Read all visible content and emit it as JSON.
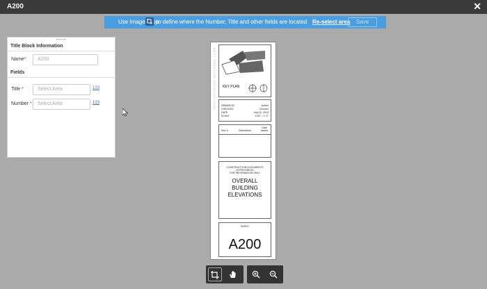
{
  "window": {
    "title": "A200",
    "close_glyph": "✕"
  },
  "banner": {
    "message_before": "Use Image Crop",
    "message_after": "to define where the Number, Title and other fields are located",
    "reselect_label": "Re-select area",
    "save_label": "Save"
  },
  "panel": {
    "title_block_header": "Title Block Information",
    "name_label": "Name",
    "name_value": "A200",
    "fields_header": "Fields",
    "title_label": "Title",
    "title_placeholder": "Select Area",
    "number_label": "Number",
    "number_placeholder": "Select Area",
    "numeric_glyph": "123"
  },
  "sheet": {
    "vertical_text": "BEST PRACTICE ARCHITECTURE",
    "key_plan_label": "KEY PLAN",
    "drawn_by_label": "DRAWN BY",
    "drawn_by_value": "Author",
    "checked_label": "CHECKED",
    "checked_value": "Checker",
    "date_label": "DATE",
    "date_value": "July 22, 2013",
    "scale_label": "SCALE",
    "scale_value": "1/16\" = 1'-0\"",
    "rev_col": "Rev. #",
    "desc_col": "Description",
    "date_col": "Date Issued",
    "notice_lines": [
      "CONSTRUCTION DOCUMENTS",
      "IN PROGRESS",
      "FOR INFORMATION ONLY"
    ],
    "sheet_title_lines": [
      "OVERALL",
      "BUILDING",
      "ELEVATIONS"
    ],
    "sheet_label": "SHEET",
    "sheet_number": "A200"
  },
  "toolbar": {
    "crop_icon": "crop-icon",
    "pan_icon": "hand-icon",
    "zoom_in_icon": "zoom-in-icon",
    "zoom_out_icon": "zoom-out-icon"
  },
  "colors": {
    "banner": "#4a9de0",
    "titlebar": "#3a3a3a",
    "background": "#aaaaaa"
  }
}
